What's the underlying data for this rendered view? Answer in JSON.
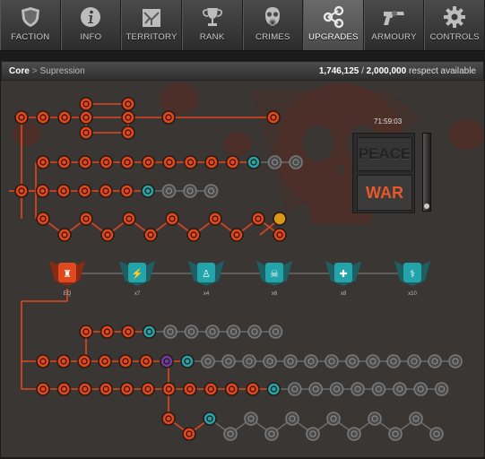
{
  "nav": {
    "tabs": [
      {
        "label": "FACTION",
        "icon": "shield-icon",
        "active": false
      },
      {
        "label": "INFO",
        "icon": "info-icon",
        "active": false
      },
      {
        "label": "TERRITORY",
        "icon": "map-icon",
        "active": false
      },
      {
        "label": "RANK",
        "icon": "trophy-icon",
        "active": false
      },
      {
        "label": "CRIMES",
        "icon": "gasmask-icon",
        "active": false
      },
      {
        "label": "UPGRADES",
        "icon": "share-nodes-icon",
        "active": true
      },
      {
        "label": "ARMOURY",
        "icon": "pistol-icon",
        "active": false
      },
      {
        "label": "CONTROLS",
        "icon": "gear-icon",
        "active": false
      }
    ]
  },
  "breadcrumb": {
    "root": "Core",
    "separator": ">",
    "current": "Supression"
  },
  "respect": {
    "current": "1,746,125",
    "total": "2,000,000",
    "suffix": "respect available"
  },
  "timer": "71:59:03",
  "toggle": {
    "peace": "PEACE",
    "war": "WAR",
    "war_selected": true
  },
  "milestones": [
    {
      "icon": "tower-icon",
      "label": "EQ",
      "active": true,
      "color": "#e0481e"
    },
    {
      "icon": "bolt-icon",
      "label": "x7",
      "active": false,
      "color": "#23a4aa"
    },
    {
      "icon": "body-icon",
      "label": "x4",
      "active": false,
      "color": "#23a4aa"
    },
    {
      "icon": "skull-icon",
      "label": "x6",
      "active": false,
      "color": "#23a4aa"
    },
    {
      "icon": "firstaid-icon",
      "label": "x8",
      "active": false,
      "color": "#23a4aa"
    },
    {
      "icon": "caduceus-icon",
      "label": "x10",
      "active": false,
      "color": "#23a4aa"
    }
  ],
  "colors": {
    "unlocked": "#e0481e",
    "available": "#23a4aa",
    "locked": "#6a6a6a",
    "special": "#6b3fa0",
    "gold": "#d89818"
  }
}
